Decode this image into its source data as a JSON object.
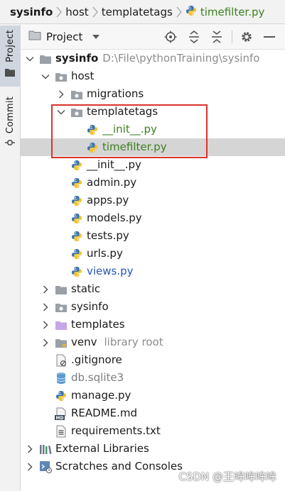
{
  "breadcrumb": {
    "items": [
      "sysinfo",
      "host",
      "templatetags",
      "timefilter.py"
    ]
  },
  "side_tabs": {
    "project": "Project",
    "commit": "Commit"
  },
  "project_panel": {
    "title": "Project"
  },
  "tree": [
    {
      "label": "sysinfo",
      "suffix": "D:\\File\\pythonTraining\\sysinfo"
    },
    {
      "label": "host",
      "suffix": ""
    },
    {
      "label": "migrations",
      "suffix": ""
    },
    {
      "label": "templatetags",
      "suffix": ""
    },
    {
      "label": "__init__.py",
      "suffix": ""
    },
    {
      "label": "timefilter.py",
      "suffix": ""
    },
    {
      "label": "__init__.py",
      "suffix": ""
    },
    {
      "label": "admin.py",
      "suffix": ""
    },
    {
      "label": "apps.py",
      "suffix": ""
    },
    {
      "label": "models.py",
      "suffix": ""
    },
    {
      "label": "tests.py",
      "suffix": ""
    },
    {
      "label": "urls.py",
      "suffix": ""
    },
    {
      "label": "views.py",
      "suffix": ""
    },
    {
      "label": "static",
      "suffix": ""
    },
    {
      "label": "sysinfo",
      "suffix": ""
    },
    {
      "label": "templates",
      "suffix": ""
    },
    {
      "label": "venv",
      "suffix": "library root"
    },
    {
      "label": ".gitignore",
      "suffix": ""
    },
    {
      "label": "db.sqlite3",
      "suffix": ""
    },
    {
      "label": "manage.py",
      "suffix": ""
    },
    {
      "label": "README.md",
      "suffix": ""
    },
    {
      "label": "requirements.txt",
      "suffix": ""
    },
    {
      "label": "External Libraries",
      "suffix": ""
    },
    {
      "label": "Scratches and Consoles",
      "suffix": ""
    }
  ],
  "watermark": "CSDN @王哞哞哞哞",
  "colors": {
    "selection": "#d5d5d5",
    "annotation": "#d9342b",
    "modified_green": "#3b7f1e",
    "changed_blue": "#2456b8",
    "folder": "#8a8f96",
    "python_blue": "#3d74ab",
    "python_yellow": "#f2c230"
  }
}
